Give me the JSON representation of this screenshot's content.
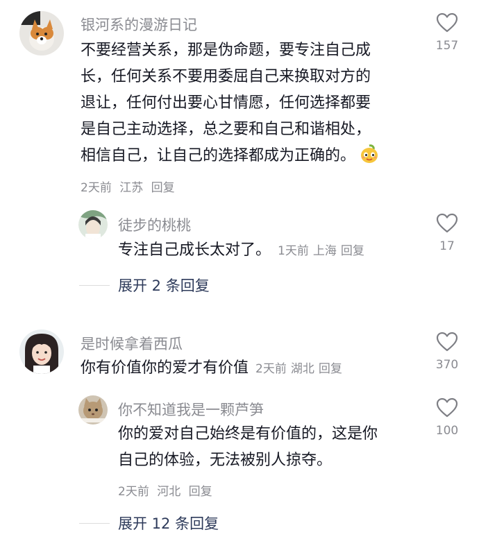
{
  "comments": [
    {
      "username": "银河系的漫游日记",
      "lines": [
        "不要经营关系，那是伪命题，要专注自己成",
        "长，任何关系不要用委屈自己来换取对方的",
        "退让，任何付出要心甘情愿，任何选择都要",
        "是自己主动选择，总之要和自己和谐相处，",
        "相信自己，让自己的选择都成为正确的。"
      ],
      "time": "2天前",
      "location": "江苏",
      "reply_label": "回复",
      "likes": "157"
    },
    {
      "username": "徒步的桃桃",
      "text": "专注自己成长太对了。",
      "time": "1天前",
      "location": "上海",
      "reply_label": "回复",
      "likes": "17"
    },
    {
      "username": "是时候拿着西瓜",
      "text": "你有价值你的爱才有价值",
      "time": "2天前",
      "location": "湖北",
      "reply_label": "回复",
      "likes": "370"
    },
    {
      "username": "你不知道我是一颗芦笋",
      "lines": [
        "你的爱对自己始终是有价值的，这是你",
        "自己的体验，无法被别人掠夺。"
      ],
      "time": "2天前",
      "location": "河北",
      "reply_label": "回复",
      "likes": "100"
    }
  ],
  "expand1": "展开 2 条回复",
  "expand2": "展开 12 条回复"
}
